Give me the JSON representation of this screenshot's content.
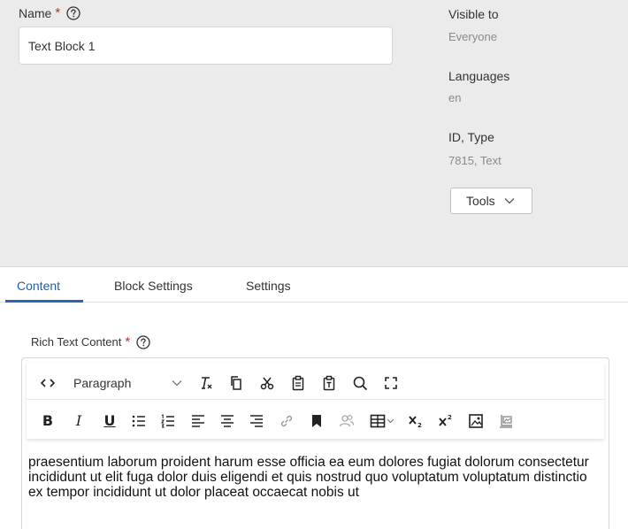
{
  "form": {
    "name_label": "Name",
    "required_mark": "*",
    "name_value": "Text Block 1"
  },
  "meta": {
    "visible_to_label": "Visible to",
    "visible_to_value": "Everyone",
    "languages_label": "Languages",
    "languages_value": "en",
    "id_type_label": "ID, Type",
    "id_type_value": "7815, Text",
    "tools_label": "Tools"
  },
  "tabs": [
    {
      "label": "Content",
      "active": true
    },
    {
      "label": "Block Settings",
      "active": false
    },
    {
      "label": "Settings",
      "active": false
    }
  ],
  "editor": {
    "field_label": "Rich Text Content",
    "required_mark": "*",
    "paragraph_select": "Paragraph",
    "toolbar_row1": [
      "source-code-icon",
      "paragraph-select",
      "clear-formatting-icon",
      "copy-icon",
      "cut-icon",
      "paste-icon",
      "paste-text-icon",
      "find-icon",
      "fullscreen-icon"
    ],
    "toolbar_row2": [
      "bold-icon",
      "italic-icon",
      "underline-icon",
      "bullet-list-icon",
      "numbered-list-icon",
      "align-left-icon",
      "align-center-icon",
      "align-right-icon",
      "link-icon",
      "bookmark-icon",
      "user-mention-icon",
      "table-icon",
      "subscript-icon",
      "superscript-icon",
      "image-icon",
      "media-icon"
    ],
    "content": "praesentium laborum proident harum esse officia ea eum dolores fugiat dolorum consectetur incididunt ut elit fuga dolor duis eligendi et quis nostrud quo voluptatum voluptatum distinctio ex tempor incididunt ut dolor placeat occaecat nobis ut"
  },
  "colors": {
    "panel_bg": "#ebebeb",
    "accent": "#2a64b5",
    "required": "#e02020"
  }
}
